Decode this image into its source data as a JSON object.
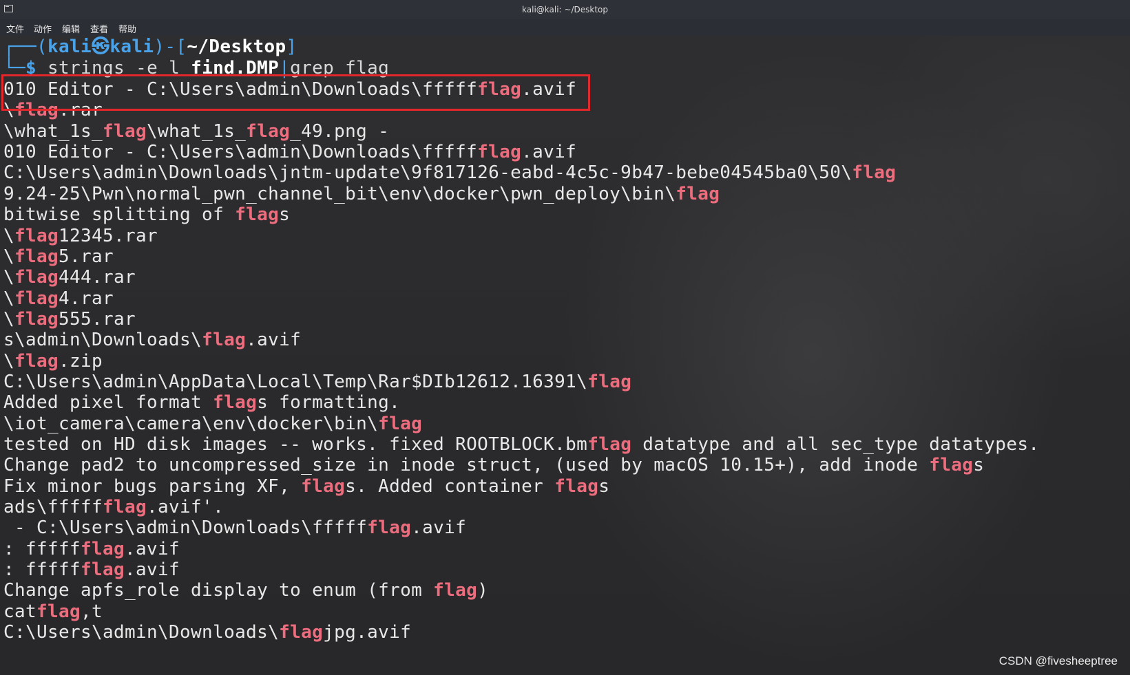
{
  "window": {
    "title": "kali@kali: ~/Desktop"
  },
  "menu": [
    "文件",
    "动作",
    "编辑",
    "查看",
    "帮助"
  ],
  "prompt": {
    "frame_open": "┌──(",
    "user": "kali㉿kali",
    "frame_mid": ")-[",
    "dir": "~/Desktop",
    "frame_close": "]",
    "dollar_prefix": "└─$",
    "cmd": "strings",
    "flag": "-e l",
    "file": "find.DMP",
    "pipe": "|",
    "grep": "grep flag"
  },
  "output_lines": [
    [
      "010 Editor - C:\\Users\\admin\\Downloads\\fffff",
      "flag",
      ".avif"
    ],
    [
      "\\",
      "flag",
      ".rar"
    ],
    [
      "\\what_1s_",
      "flag",
      "\\what_1s_",
      "flag",
      "_49.png -"
    ],
    [
      "010 Editor - C:\\Users\\admin\\Downloads\\fffff",
      "flag",
      ".avif"
    ],
    [
      "C:\\Users\\admin\\Downloads\\jntm-update\\9f817126-eabd-4c5c-9b47-bebe04545ba0\\50\\",
      "flag"
    ],
    [
      "9.24-25\\Pwn\\normal_pwn_channel_bit\\env\\docker\\pwn_deploy\\bin\\",
      "flag"
    ],
    [
      "bitwise splitting of ",
      "flag",
      "s"
    ],
    [
      "\\",
      "flag",
      "12345.rar"
    ],
    [
      "\\",
      "flag",
      "5.rar"
    ],
    [
      "\\",
      "flag",
      "444.rar"
    ],
    [
      "\\",
      "flag",
      "4.rar"
    ],
    [
      "\\",
      "flag",
      "555.rar"
    ],
    [
      "s\\admin\\Downloads\\",
      "flag",
      ".avif"
    ],
    [
      "\\",
      "flag",
      ".zip"
    ],
    [
      "C:\\Users\\admin\\AppData\\Local\\Temp\\Rar$DIb12612.16391\\",
      "flag"
    ],
    [
      "Added pixel format ",
      "flag",
      "s formatting."
    ],
    [
      "\\iot_camera\\camera\\env\\docker\\bin\\",
      "flag"
    ],
    [
      "tested on HD disk images -- works. fixed ROOTBLOCK.bm",
      "flag",
      " datatype and all sec_type datatypes."
    ],
    [
      "Change pad2 to uncompressed_size in inode struct, (used by macOS 10.15+), add inode ",
      "flag",
      "s"
    ],
    [
      "Fix minor bugs parsing XF, ",
      "flag",
      "s. Added container ",
      "flag",
      "s"
    ],
    [
      "ads\\fffff",
      "flag",
      ".avif'."
    ],
    [
      " - C:\\Users\\admin\\Downloads\\fffff",
      "flag",
      ".avif"
    ],
    [
      ": fffff",
      "flag",
      ".avif"
    ],
    [
      ": fffff",
      "flag",
      ".avif"
    ],
    [
      "Change apfs_role display to enum (from ",
      "flag",
      ")"
    ],
    [
      "cat",
      "flag",
      ",t"
    ],
    [
      "C:\\Users\\admin\\Downloads\\",
      "flag",
      "jpg.avif"
    ]
  ],
  "watermark": "CSDN @fivesheeptree",
  "colors": {
    "highlight": "#ec6d7d",
    "prompt": "#4aa2e8",
    "box": "#e3272b"
  }
}
